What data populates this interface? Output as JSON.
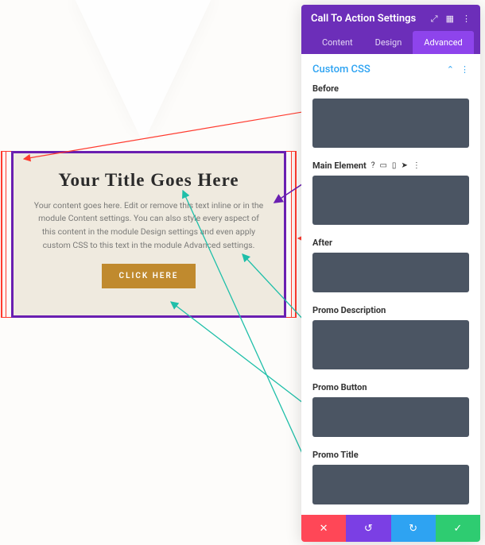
{
  "panel": {
    "title": "Call To Action Settings",
    "tabs": {
      "content": "Content",
      "design": "Design",
      "advanced": "Advanced"
    },
    "section_title": "Custom CSS",
    "fields": {
      "before": "Before",
      "main_element": "Main Element",
      "after": "After",
      "promo_desc": "Promo Description",
      "promo_button": "Promo Button",
      "promo_title": "Promo Title"
    }
  },
  "promo": {
    "title": "Your Title Goes Here",
    "description": "Your content goes here. Edit or remove this text inline or in the module Content settings. You can also style every aspect of this content in the module Design settings and even apply custom CSS to this text in the module Advanced settings.",
    "button": "CLICK HERE"
  }
}
